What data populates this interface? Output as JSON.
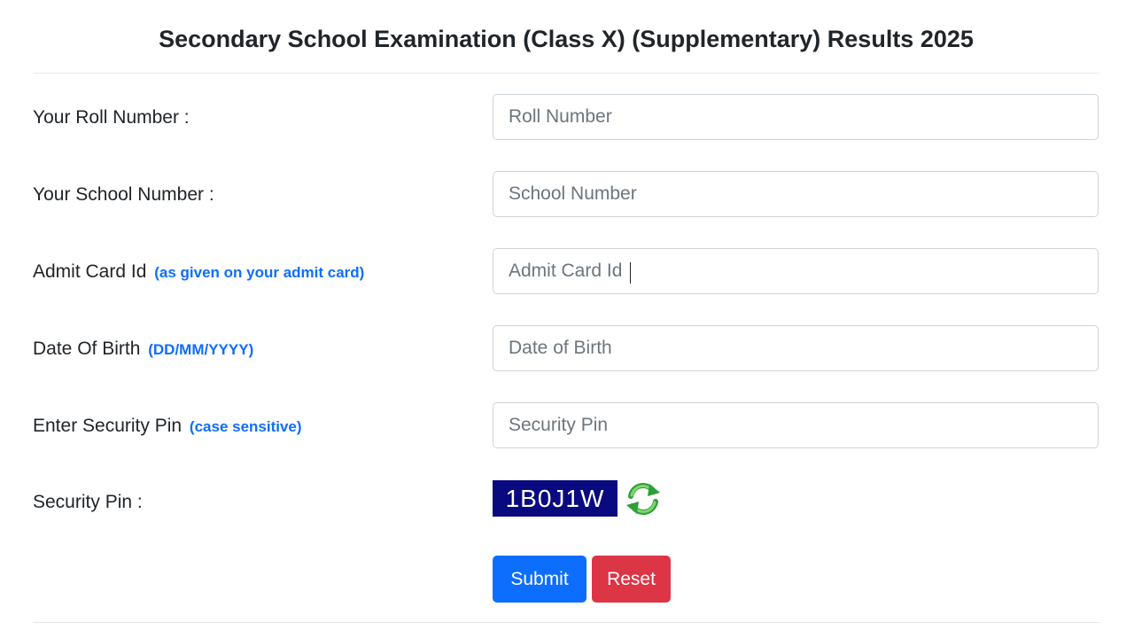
{
  "page": {
    "title": "Secondary School Examination (Class X) (Supplementary) Results 2025"
  },
  "form": {
    "roll": {
      "label": "Your Roll Number :",
      "placeholder": "Roll Number",
      "value": ""
    },
    "school": {
      "label": "Your School Number :",
      "placeholder": "School Number",
      "value": ""
    },
    "admit": {
      "label": "Admit Card Id",
      "hint": "(as given on your admit card)",
      "placeholder": "Admit Card Id",
      "value": ""
    },
    "dob": {
      "label": "Date Of Birth",
      "hint": "(DD/MM/YYYY)",
      "placeholder": "Date of Birth",
      "value": ""
    },
    "pin": {
      "label": "Enter Security Pin",
      "hint": "(case sensitive)",
      "placeholder": "Security Pin",
      "value": ""
    },
    "captcha": {
      "label": "Security Pin :",
      "code": "1B0J1W",
      "refresh_icon": "refresh-icon"
    },
    "submit_label": "Submit",
    "reset_label": "Reset"
  },
  "colors": {
    "primary": "#0d6efd",
    "danger": "#dc3545",
    "captcha_bg": "#0a0a80",
    "refresh_green": "#3cb043"
  }
}
